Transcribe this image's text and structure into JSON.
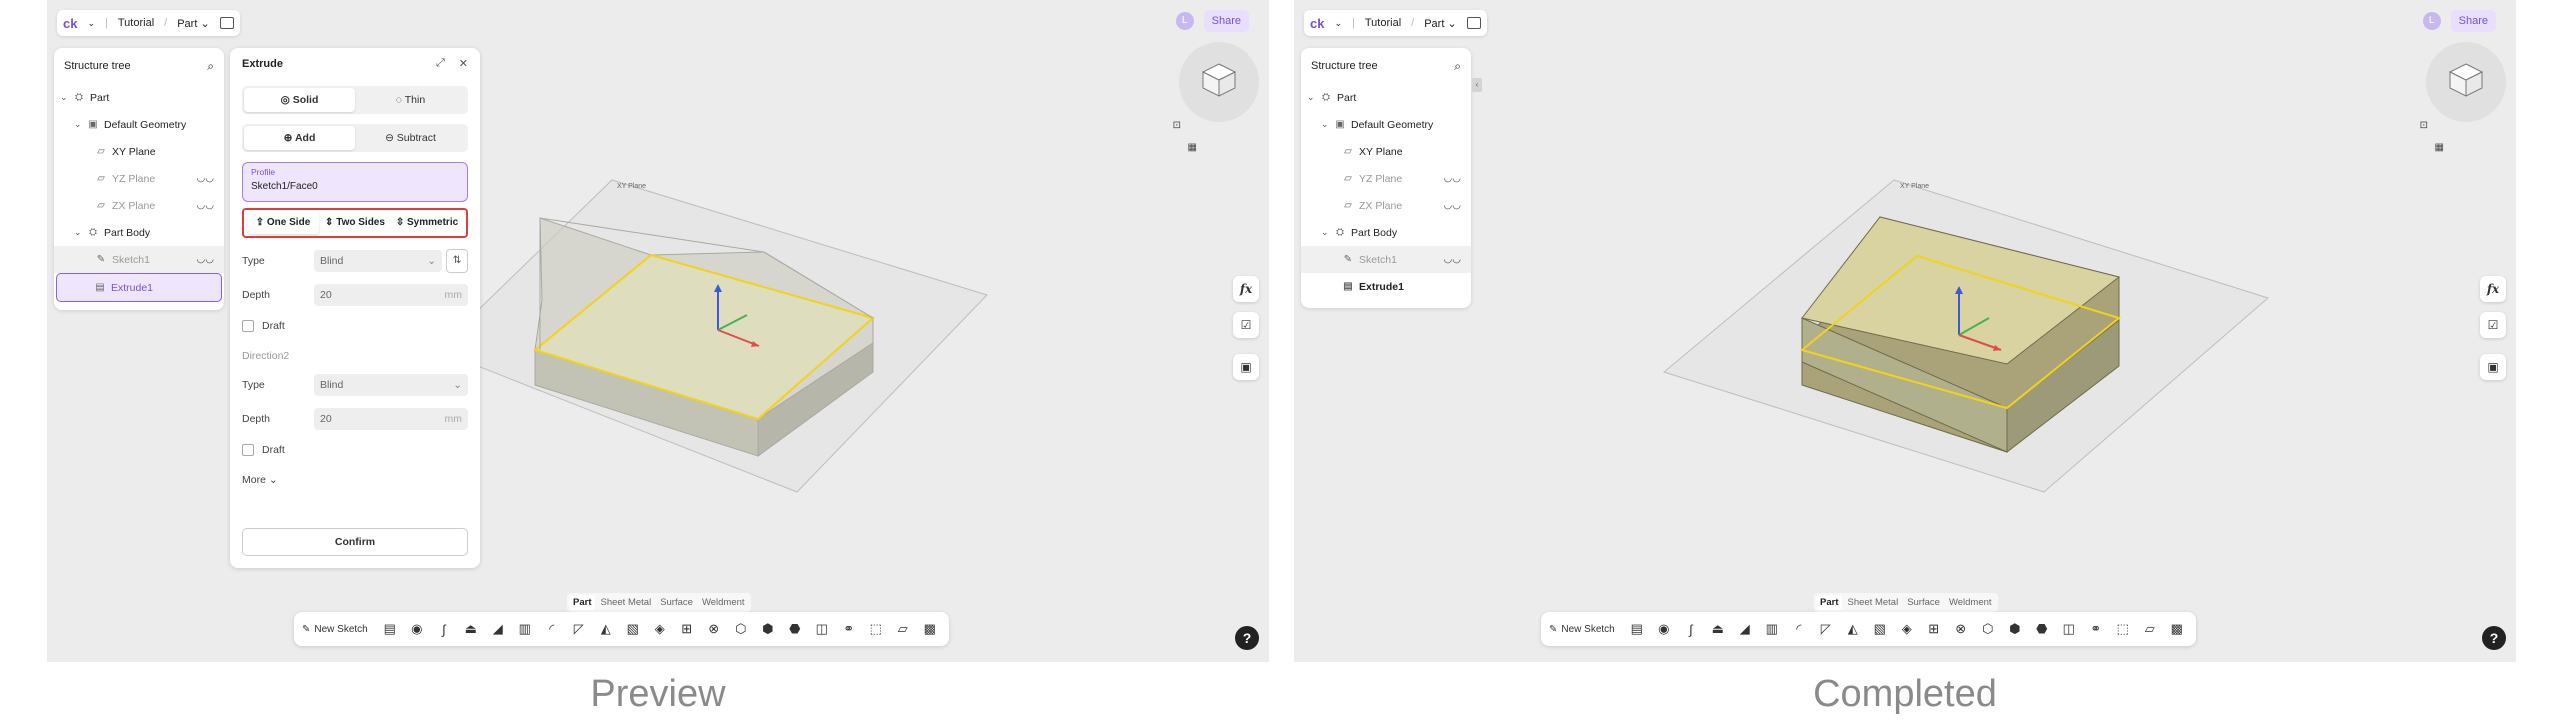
{
  "captions": {
    "left": "Preview",
    "right": "Completed"
  },
  "topbar": {
    "logo": "ck",
    "breadcrumb_project": "Tutorial",
    "breadcrumb_doc": "Part",
    "user_initial": "L",
    "share": "Share"
  },
  "tree": {
    "title": "Structure tree",
    "rows": [
      {
        "label": "Part"
      },
      {
        "label": "Default Geometry"
      },
      {
        "label": "XY Plane"
      },
      {
        "label": "YZ Plane"
      },
      {
        "label": "ZX Plane"
      },
      {
        "label": "Part Body"
      },
      {
        "label": "Sketch1"
      },
      {
        "label": "Extrude1"
      }
    ]
  },
  "extrude": {
    "title": "Extrude",
    "solid": "Solid",
    "thin": "Thin",
    "add": "Add",
    "subtract": "Subtract",
    "profile_label": "Profile",
    "profile_value": "Sketch1/Face0",
    "one_side": "One Side",
    "two_sides": "Two Sides",
    "symmetric": "Symmetric",
    "type_label": "Type",
    "type_value": "Blind",
    "depth_label": "Depth",
    "depth_value": "20",
    "unit": "mm",
    "draft_label": "Draft",
    "direction2_label": "Direction2",
    "type2_label": "Type",
    "type2_value": "Blind",
    "depth2_label": "Depth",
    "depth2_value": "20",
    "draft2_label": "Draft",
    "more": "More",
    "confirm": "Confirm"
  },
  "viewcube": {
    "plane_label": "XY Plane"
  },
  "side_tools": {
    "fx": "fx"
  },
  "mode_tabs": [
    "Part",
    "Sheet Metal",
    "Surface",
    "Weldment"
  ],
  "toolbar": {
    "new_sketch": "New Sketch"
  },
  "help": "?",
  "colors": {
    "accent": "#7b4fd6",
    "highlight_red": "#e13c3c",
    "sketch_yellow": "#f2d21b",
    "preview_box": "#c9c9b8",
    "completed_box": "#b9b27a"
  }
}
